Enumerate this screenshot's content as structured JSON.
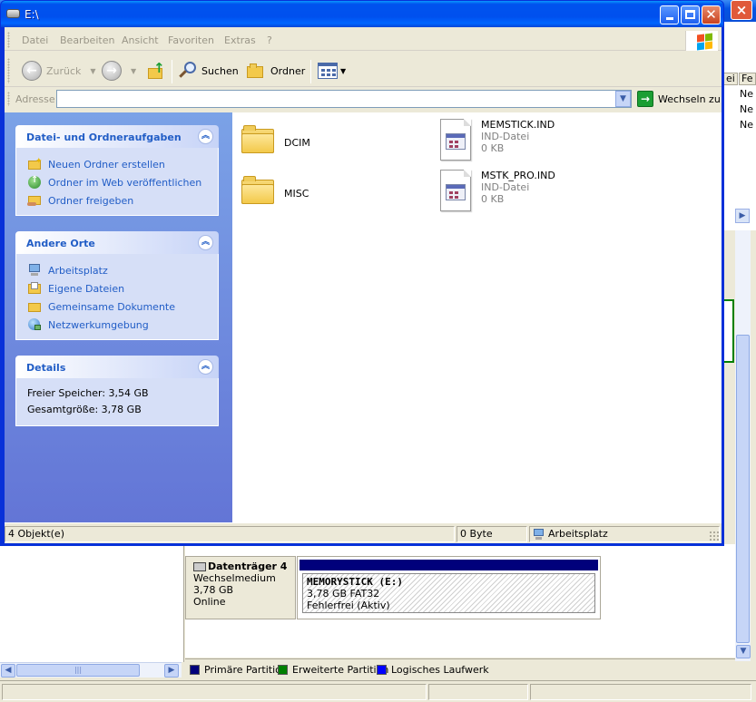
{
  "window": {
    "title": "E:\\"
  },
  "menu": [
    "Datei",
    "Bearbeiten",
    "Ansicht",
    "Favoriten",
    "Extras",
    "?"
  ],
  "toolbar": {
    "back": "Zurück",
    "search": "Suchen",
    "folders": "Ordner"
  },
  "address": {
    "label": "Adresse",
    "value": "",
    "go": "Wechseln zu"
  },
  "tasks_panel": {
    "title": "Datei- und Ordneraufgaben",
    "items": [
      {
        "label": "Neuen Ordner erstellen",
        "icon": "new-folder-icon"
      },
      {
        "label": "Ordner im Web veröffentlichen",
        "icon": "publish-web-icon"
      },
      {
        "label": "Ordner freigeben",
        "icon": "share-folder-icon"
      }
    ]
  },
  "places_panel": {
    "title": "Andere Orte",
    "items": [
      {
        "label": "Arbeitsplatz",
        "icon": "my-computer-icon"
      },
      {
        "label": "Eigene Dateien",
        "icon": "my-documents-icon"
      },
      {
        "label": "Gemeinsame Dokumente",
        "icon": "shared-documents-icon"
      },
      {
        "label": "Netzwerkumgebung",
        "icon": "network-places-icon"
      }
    ]
  },
  "details_panel": {
    "title": "Details",
    "free": "Freier Speicher: 3,54 GB",
    "total": "Gesamtgröße: 3,78 GB"
  },
  "files": [
    {
      "name": "DCIM",
      "type": "folder"
    },
    {
      "name": "MISC",
      "type": "folder"
    },
    {
      "name": "MEMSTICK.IND",
      "kind": "IND-Datei",
      "size": "0 KB"
    },
    {
      "name": "MSTK_PRO.IND",
      "kind": "IND-Datei",
      "size": "0 KB"
    }
  ],
  "status": {
    "objects": "4 Objekt(e)",
    "size": "0 Byte",
    "location": "Arbeitsplatz"
  },
  "background": {
    "headers": [
      "ei",
      "Fe"
    ],
    "rows": [
      "Ne",
      "Ne",
      "Ne"
    ],
    "disk": {
      "name": "Datenträger 4",
      "type": "Wechselmedium",
      "size": "3,78 GB",
      "state": "Online"
    },
    "partition": {
      "name": "MEMORYSTICK  (E:)",
      "fs": "3,78 GB FAT32",
      "status": "Fehlerfrei (Aktiv)"
    },
    "legend": [
      {
        "label": "Primäre Partition",
        "color": "#00007b"
      },
      {
        "label": "Erweiterte Partition",
        "color": "#008000"
      },
      {
        "label": "Logisches Laufwerk",
        "color": "#0000ff"
      }
    ]
  }
}
